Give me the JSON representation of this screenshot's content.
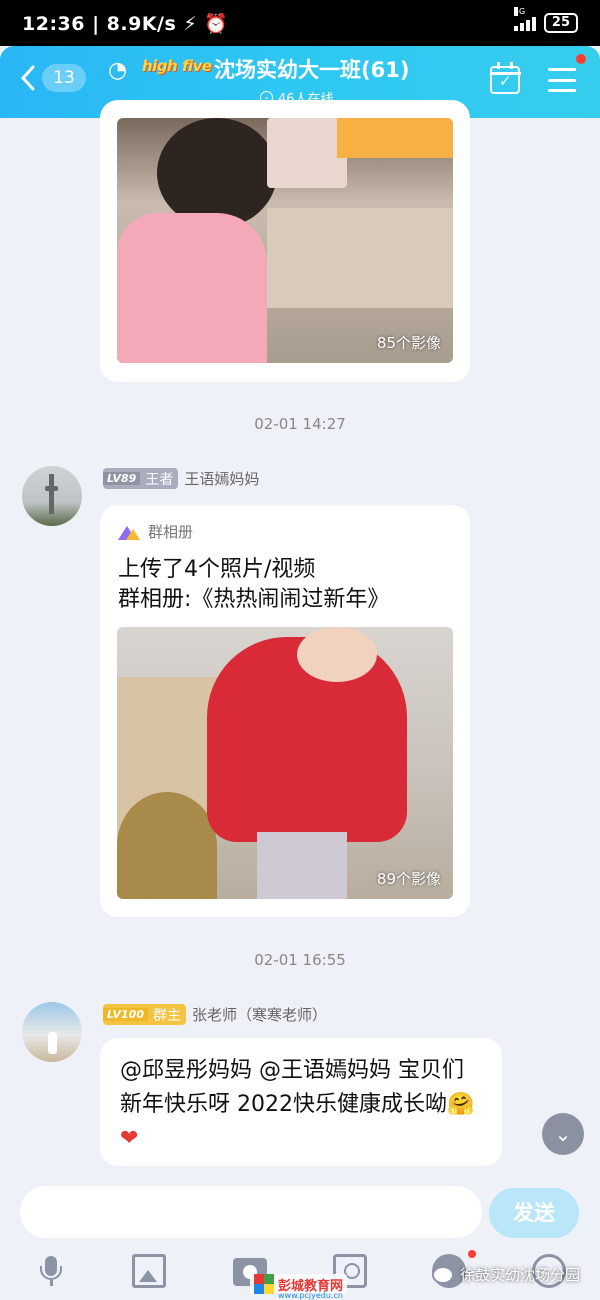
{
  "status_bar": {
    "time": "12:36",
    "speed": "8.9K/s",
    "network": "4G",
    "battery": "25"
  },
  "header": {
    "unread_count": "13",
    "logo_text": "high five",
    "title": "沈场实幼大一班(61)",
    "online": "46人在线",
    "accent_color": "#2ab9f4"
  },
  "messages": {
    "top_album": {
      "photo_count": "85个影像"
    },
    "ts1": "02-01 14:27",
    "msg1": {
      "level": "LV89",
      "rank": "王者",
      "name": "王语嫣妈妈",
      "album_label": "群相册",
      "line1": "上传了4个照片/视频",
      "line2": "群相册:《热热闹闹过新年》",
      "photo_count": "89个影像"
    },
    "ts2": "02-01 16:55",
    "msg2": {
      "level": "LV100",
      "rank": "群主",
      "name": "张老师（寒寒老师）",
      "text": "@邱昱彤妈妈 @王语嫣妈妈 宝贝们新年快乐呀  2022快乐健康成长呦",
      "emoji": "🤗❤"
    }
  },
  "input": {
    "placeholder": "",
    "send_label": "发送"
  },
  "watermarks": {
    "site_title": "彭城教育网",
    "site_url": "www.pcjyedu.cn",
    "wechat_account": "徐鼓实幼沈场分园"
  }
}
